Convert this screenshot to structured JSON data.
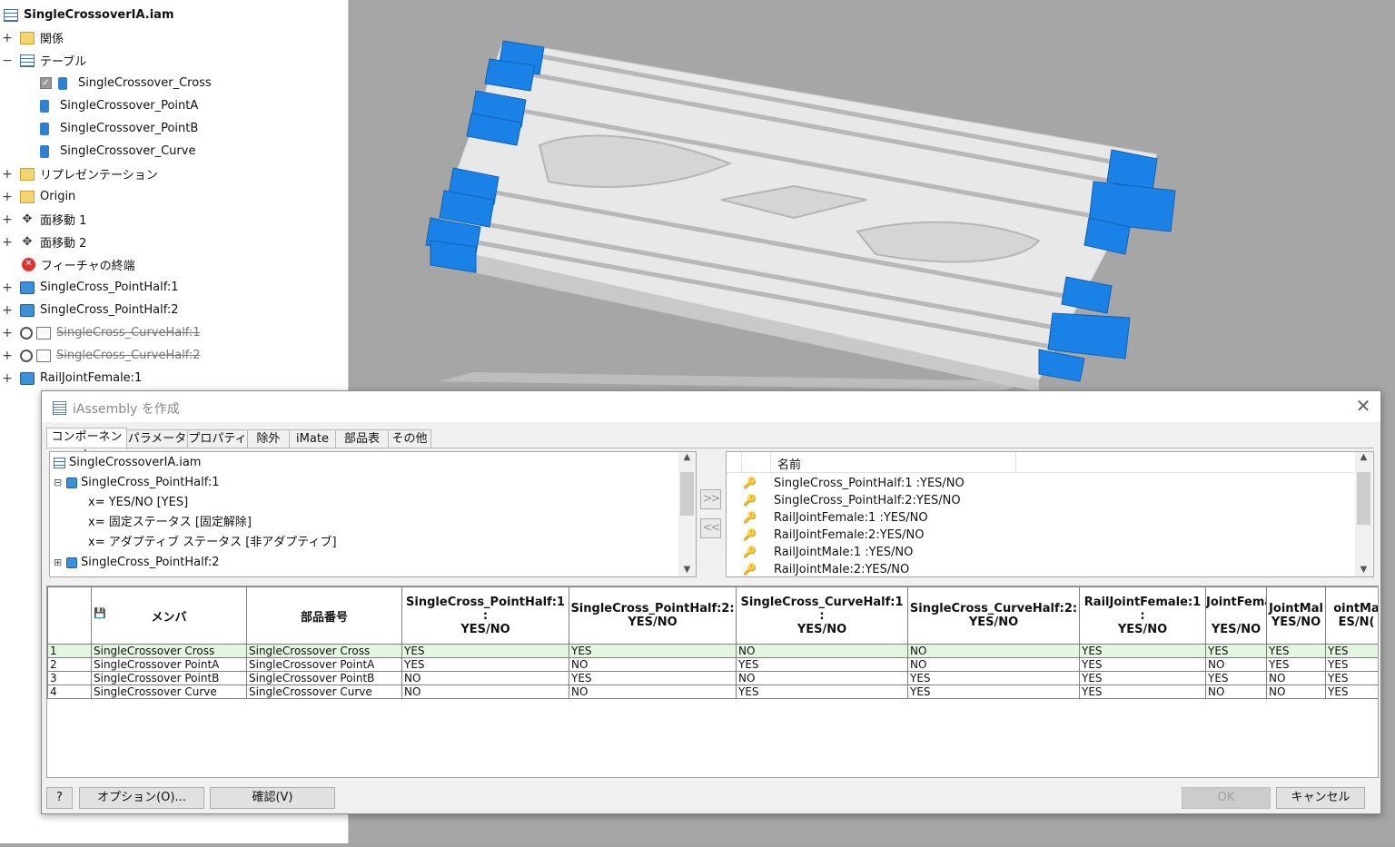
{
  "browser": {
    "title": "SingleCrossoverIA.iam",
    "items": [
      {
        "label": "関係"
      },
      {
        "label": "テーブル"
      },
      {
        "label": "SingleCrossover_Cross"
      },
      {
        "label": "SingleCrossover_PointA"
      },
      {
        "label": "SingleCrossover_PointB"
      },
      {
        "label": "SingleCrossover_Curve"
      },
      {
        "label": "リプレゼンテーション"
      },
      {
        "label": "Origin"
      },
      {
        "label": "面移動 1"
      },
      {
        "label": "面移動 2"
      },
      {
        "label": "フィーチャの終端"
      },
      {
        "label": "SingleCross_PointHalf:1"
      },
      {
        "label": "SingleCross_PointHalf:2"
      },
      {
        "label": "SingleCross_CurveHalf:1"
      },
      {
        "label": "SingleCross_CurveHalf:2"
      },
      {
        "label": "RailJointFemale:1"
      }
    ]
  },
  "dialog": {
    "title": "iAssembly を作成",
    "tabs": [
      "コンポーネント",
      "パラメータ",
      "プロパティ",
      "除外",
      "iMate",
      "部品表",
      "その他"
    ],
    "active_tab": "コンポーネント",
    "component_tree": [
      {
        "label": "SingleCrossoverIA.iam"
      },
      {
        "label": "SingleCross_PointHalf:1"
      },
      {
        "label": "x= YES/NO [YES]"
      },
      {
        "label": "x= 固定ステータス [固定解除]"
      },
      {
        "label": "x= アダプティブ ステータス [非アダプティブ]"
      },
      {
        "label": "SingleCross_PointHalf:2"
      }
    ],
    "add_button": ">>",
    "remove_button": "<<",
    "param_list": {
      "header": "名前",
      "items": [
        "SingleCross_PointHalf:1 :YES/NO",
        "SingleCross_PointHalf:2:YES/NO",
        "RailJointFemale:1 :YES/NO",
        "RailJointFemale:2:YES/NO",
        "RailJointMale:1 :YES/NO",
        "RailJointMale:2:YES/NO"
      ]
    },
    "table": {
      "headers": [
        "メンバ",
        "部品番号",
        "SingleCross_PointHalf:1 :\nYES/NO",
        "SingleCross_PointHalf:2:\nYES/NO",
        "SingleCross_CurveHalf:1 :\nYES/NO",
        "SingleCross_CurveHalf:2:\nYES/NO",
        "RailJointFemale:1 :\nYES/NO",
        "JointFema\n\nYES/NO",
        "JointMal\nYES/NO",
        "ointMa\nES/N("
      ],
      "rows": [
        [
          "1",
          "SingleCrossover Cross",
          "SingleCrossover Cross",
          "YES",
          "YES",
          "NO",
          "NO",
          "YES",
          "YES",
          "YES",
          "YES"
        ],
        [
          "2",
          "SingleCrossover PointA",
          "SingleCrossover PointA",
          "YES",
          "NO",
          "YES",
          "NO",
          "YES",
          "NO",
          "YES",
          "YES"
        ],
        [
          "3",
          "SingleCrossover PointB",
          "SingleCrossover PointB",
          "NO",
          "YES",
          "NO",
          "YES",
          "YES",
          "YES",
          "NO",
          "YES"
        ],
        [
          "4",
          "SingleCrossover Curve",
          "SingleCrossover Curve",
          "NO",
          "NO",
          "YES",
          "YES",
          "YES",
          "NO",
          "NO",
          "YES"
        ]
      ]
    },
    "buttons": {
      "help": "?",
      "options": "オプション(O)...",
      "verify": "確認(V)",
      "ok": "OK",
      "cancel": "キャンセル"
    }
  },
  "colors": {
    "accent_blue": "#1a82e6",
    "model_grey": "#e6e6e6",
    "selected_row": "#e3f6df"
  }
}
